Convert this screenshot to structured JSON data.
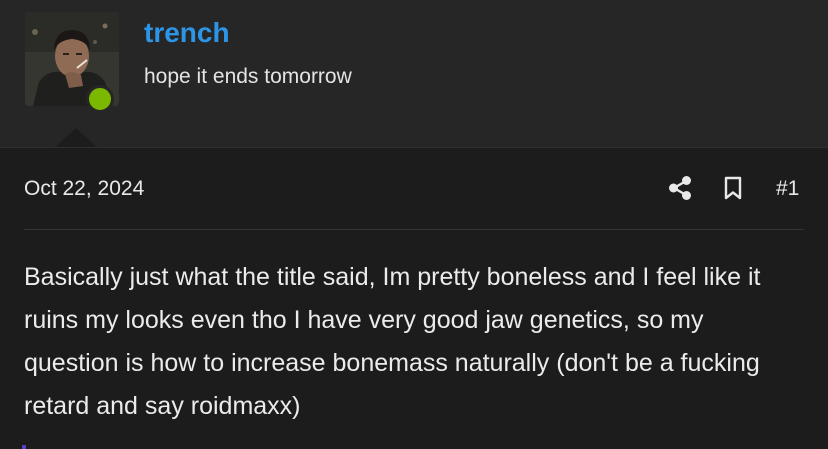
{
  "user": {
    "username": "trench",
    "title": "hope it ends tomorrow",
    "online": true,
    "online_color": "#7bb800",
    "username_color": "#2d95e6"
  },
  "post": {
    "date": "Oct 22, 2024",
    "number": "#1",
    "actions": [
      "share-icon",
      "bookmark-icon"
    ],
    "body": "Basically just what the title said, Im pretty boneless and I feel like it ruins my looks even tho I have very good jaw genetics, so my question is how to increase bonemass naturally (don't be a fucking retard and say roidmaxx)"
  }
}
